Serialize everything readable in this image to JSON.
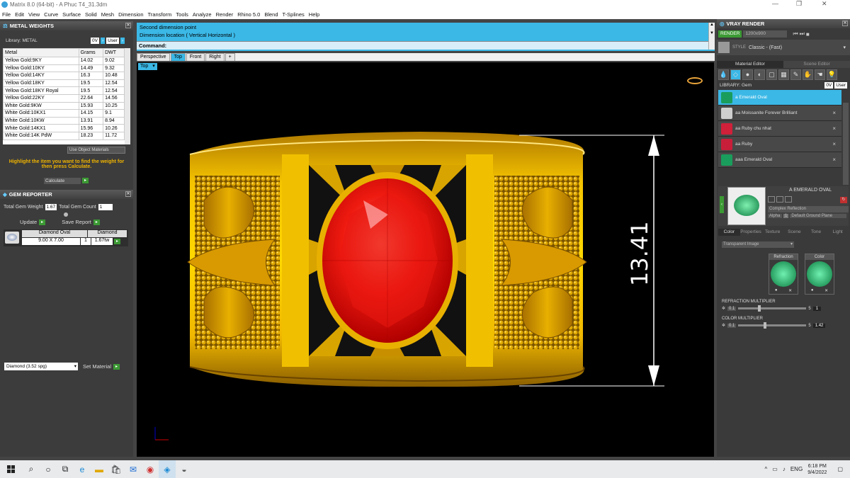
{
  "window": {
    "title": "Matrix 8.0 (64-bit) - A Phuc T4_31.3dm"
  },
  "menu": [
    "File",
    "Edit",
    "View",
    "Curve",
    "Surface",
    "Solid",
    "Mesh",
    "Dimension",
    "Transform",
    "Tools",
    "Analyze",
    "Render",
    "Rhino 5.0",
    "Blend",
    "T-Splines",
    "Help"
  ],
  "metal_weights": {
    "title": "METAL WEIGHTS",
    "library_label": "Library: METAL",
    "tag_0v": "0V",
    "tag_user": "User",
    "columns": [
      "Metal",
      "Grams",
      "DWT"
    ],
    "rows": [
      [
        "Yellow Gold:9KY",
        "14.02",
        "9.02"
      ],
      [
        "Yellow Gold:10KY",
        "14.49",
        "9.32"
      ],
      [
        "Yellow Gold:14KY",
        "16.3",
        "10.48"
      ],
      [
        "Yellow Gold:18KY",
        "19.5",
        "12.54"
      ],
      [
        "Yellow Gold:18KY Royal",
        "19.5",
        "12.54"
      ],
      [
        "Yellow Gold:22KY",
        "22.64",
        "14.56"
      ],
      [
        "White Gold:9KW",
        "15.93",
        "10.25"
      ],
      [
        "White Gold:10KX1",
        "14.15",
        "9.1"
      ],
      [
        "White Gold:10KW",
        "13.91",
        "8.94"
      ],
      [
        "White Gold:14KX1",
        "15.96",
        "10.26"
      ],
      [
        "White Gold:14K PdW",
        "18.23",
        "11.72"
      ]
    ],
    "use_object_materials": "Use Object Materials",
    "hint": "Highlight the item you want to find the weight for then press Calculate.",
    "calculate": "Calculate"
  },
  "gem_reporter": {
    "title": "GEM REPORTER",
    "total_weight_label": "Total Gem Weight",
    "total_weight": "1.67",
    "total_count_label": "Total Gem Count",
    "total_count": "1",
    "update": "Update",
    "save_report": "Save Report",
    "gem": {
      "shape": "Diamond Oval",
      "size": "9.00 X 7.00",
      "type": "Diamond",
      "count": "1",
      "weight": "1.67tw"
    }
  },
  "bottom_left": {
    "material_select": "Diamond    (3.52 spg)",
    "set_material": "Set Material"
  },
  "command": {
    "line1": "Second dimension point",
    "line2": "Dimension location ( Vertical  Horizontal )",
    "prompt": "Command:"
  },
  "view_tabs": [
    "Perspective",
    "Top",
    "Front",
    "Right",
    "+"
  ],
  "viewport": {
    "label": "Top",
    "dimension": "13.41"
  },
  "vray": {
    "title": "VRAY RENDER",
    "render": "RENDER",
    "resolution": "1200x900",
    "style_label": "STYLE",
    "style_value": "Classic - (Fast)",
    "tabs": [
      "Material Editor",
      "Scene Editor"
    ],
    "library_label": "LIBRARY: Gem",
    "materials": [
      {
        "name": "a Emerald Oval",
        "color": "#1a9d5c"
      },
      {
        "name": "aa Moissanite Forever Brilliant",
        "color": "#cfcfcf"
      },
      {
        "name": "aa Ruby chu nhat",
        "color": "#d0203a"
      },
      {
        "name": "aa Ruby",
        "color": "#c81e3a"
      },
      {
        "name": "aaa Emerald Oval",
        "color": "#1a9d5c"
      }
    ],
    "preview_name": "A EMERALD OVAL",
    "complex": "Complex Reflection",
    "alpha": "Alpha",
    "alpha_val": "1",
    "ground": "Default Ground Plane",
    "prop_tabs": [
      "Color",
      "Properties",
      "Texture",
      "Scene",
      "Tone",
      "Light"
    ],
    "image_mode": "Transparent Image",
    "refraction": "Refraction",
    "color": "Color",
    "refr_mult_label": "REFRACTION MULTIPLIER",
    "refr_min": "0.1",
    "refr_max": "5",
    "refr_val": "1",
    "color_mult_label": "COLOR MULTIPLIER",
    "color_min": "0.1",
    "color_max": "5",
    "color_val": "1.42"
  },
  "taskbar": {
    "time": "6:18 PM",
    "date": "9/4/2022",
    "lang": "ENG"
  }
}
